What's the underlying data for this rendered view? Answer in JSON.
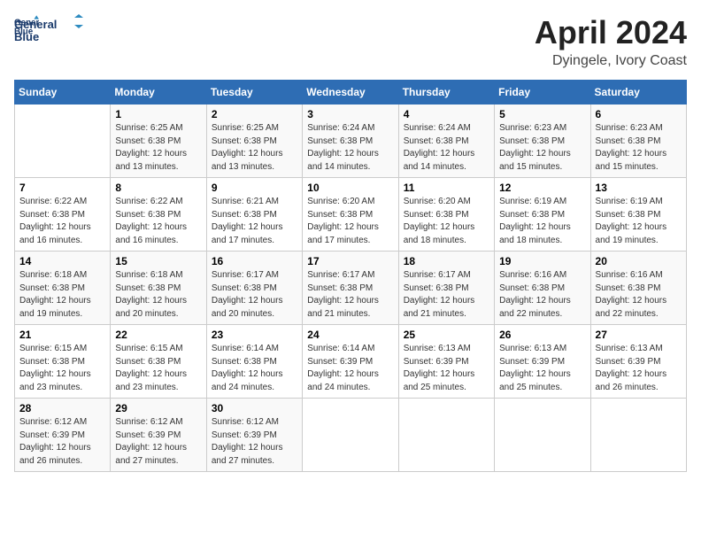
{
  "header": {
    "logo_line1": "General",
    "logo_line2": "Blue",
    "title": "April 2024",
    "subtitle": "Dyingele, Ivory Coast"
  },
  "calendar": {
    "days_of_week": [
      "Sunday",
      "Monday",
      "Tuesday",
      "Wednesday",
      "Thursday",
      "Friday",
      "Saturday"
    ],
    "weeks": [
      [
        {
          "day": "",
          "info": ""
        },
        {
          "day": "1",
          "info": "Sunrise: 6:25 AM\nSunset: 6:38 PM\nDaylight: 12 hours\nand 13 minutes."
        },
        {
          "day": "2",
          "info": "Sunrise: 6:25 AM\nSunset: 6:38 PM\nDaylight: 12 hours\nand 13 minutes."
        },
        {
          "day": "3",
          "info": "Sunrise: 6:24 AM\nSunset: 6:38 PM\nDaylight: 12 hours\nand 14 minutes."
        },
        {
          "day": "4",
          "info": "Sunrise: 6:24 AM\nSunset: 6:38 PM\nDaylight: 12 hours\nand 14 minutes."
        },
        {
          "day": "5",
          "info": "Sunrise: 6:23 AM\nSunset: 6:38 PM\nDaylight: 12 hours\nand 15 minutes."
        },
        {
          "day": "6",
          "info": "Sunrise: 6:23 AM\nSunset: 6:38 PM\nDaylight: 12 hours\nand 15 minutes."
        }
      ],
      [
        {
          "day": "7",
          "info": "Sunrise: 6:22 AM\nSunset: 6:38 PM\nDaylight: 12 hours\nand 16 minutes."
        },
        {
          "day": "8",
          "info": "Sunrise: 6:22 AM\nSunset: 6:38 PM\nDaylight: 12 hours\nand 16 minutes."
        },
        {
          "day": "9",
          "info": "Sunrise: 6:21 AM\nSunset: 6:38 PM\nDaylight: 12 hours\nand 17 minutes."
        },
        {
          "day": "10",
          "info": "Sunrise: 6:20 AM\nSunset: 6:38 PM\nDaylight: 12 hours\nand 17 minutes."
        },
        {
          "day": "11",
          "info": "Sunrise: 6:20 AM\nSunset: 6:38 PM\nDaylight: 12 hours\nand 18 minutes."
        },
        {
          "day": "12",
          "info": "Sunrise: 6:19 AM\nSunset: 6:38 PM\nDaylight: 12 hours\nand 18 minutes."
        },
        {
          "day": "13",
          "info": "Sunrise: 6:19 AM\nSunset: 6:38 PM\nDaylight: 12 hours\nand 19 minutes."
        }
      ],
      [
        {
          "day": "14",
          "info": "Sunrise: 6:18 AM\nSunset: 6:38 PM\nDaylight: 12 hours\nand 19 minutes."
        },
        {
          "day": "15",
          "info": "Sunrise: 6:18 AM\nSunset: 6:38 PM\nDaylight: 12 hours\nand 20 minutes."
        },
        {
          "day": "16",
          "info": "Sunrise: 6:17 AM\nSunset: 6:38 PM\nDaylight: 12 hours\nand 20 minutes."
        },
        {
          "day": "17",
          "info": "Sunrise: 6:17 AM\nSunset: 6:38 PM\nDaylight: 12 hours\nand 21 minutes."
        },
        {
          "day": "18",
          "info": "Sunrise: 6:17 AM\nSunset: 6:38 PM\nDaylight: 12 hours\nand 21 minutes."
        },
        {
          "day": "19",
          "info": "Sunrise: 6:16 AM\nSunset: 6:38 PM\nDaylight: 12 hours\nand 22 minutes."
        },
        {
          "day": "20",
          "info": "Sunrise: 6:16 AM\nSunset: 6:38 PM\nDaylight: 12 hours\nand 22 minutes."
        }
      ],
      [
        {
          "day": "21",
          "info": "Sunrise: 6:15 AM\nSunset: 6:38 PM\nDaylight: 12 hours\nand 23 minutes."
        },
        {
          "day": "22",
          "info": "Sunrise: 6:15 AM\nSunset: 6:38 PM\nDaylight: 12 hours\nand 23 minutes."
        },
        {
          "day": "23",
          "info": "Sunrise: 6:14 AM\nSunset: 6:38 PM\nDaylight: 12 hours\nand 24 minutes."
        },
        {
          "day": "24",
          "info": "Sunrise: 6:14 AM\nSunset: 6:39 PM\nDaylight: 12 hours\nand 24 minutes."
        },
        {
          "day": "25",
          "info": "Sunrise: 6:13 AM\nSunset: 6:39 PM\nDaylight: 12 hours\nand 25 minutes."
        },
        {
          "day": "26",
          "info": "Sunrise: 6:13 AM\nSunset: 6:39 PM\nDaylight: 12 hours\nand 25 minutes."
        },
        {
          "day": "27",
          "info": "Sunrise: 6:13 AM\nSunset: 6:39 PM\nDaylight: 12 hours\nand 26 minutes."
        }
      ],
      [
        {
          "day": "28",
          "info": "Sunrise: 6:12 AM\nSunset: 6:39 PM\nDaylight: 12 hours\nand 26 minutes."
        },
        {
          "day": "29",
          "info": "Sunrise: 6:12 AM\nSunset: 6:39 PM\nDaylight: 12 hours\nand 27 minutes."
        },
        {
          "day": "30",
          "info": "Sunrise: 6:12 AM\nSunset: 6:39 PM\nDaylight: 12 hours\nand 27 minutes."
        },
        {
          "day": "",
          "info": ""
        },
        {
          "day": "",
          "info": ""
        },
        {
          "day": "",
          "info": ""
        },
        {
          "day": "",
          "info": ""
        }
      ]
    ]
  }
}
